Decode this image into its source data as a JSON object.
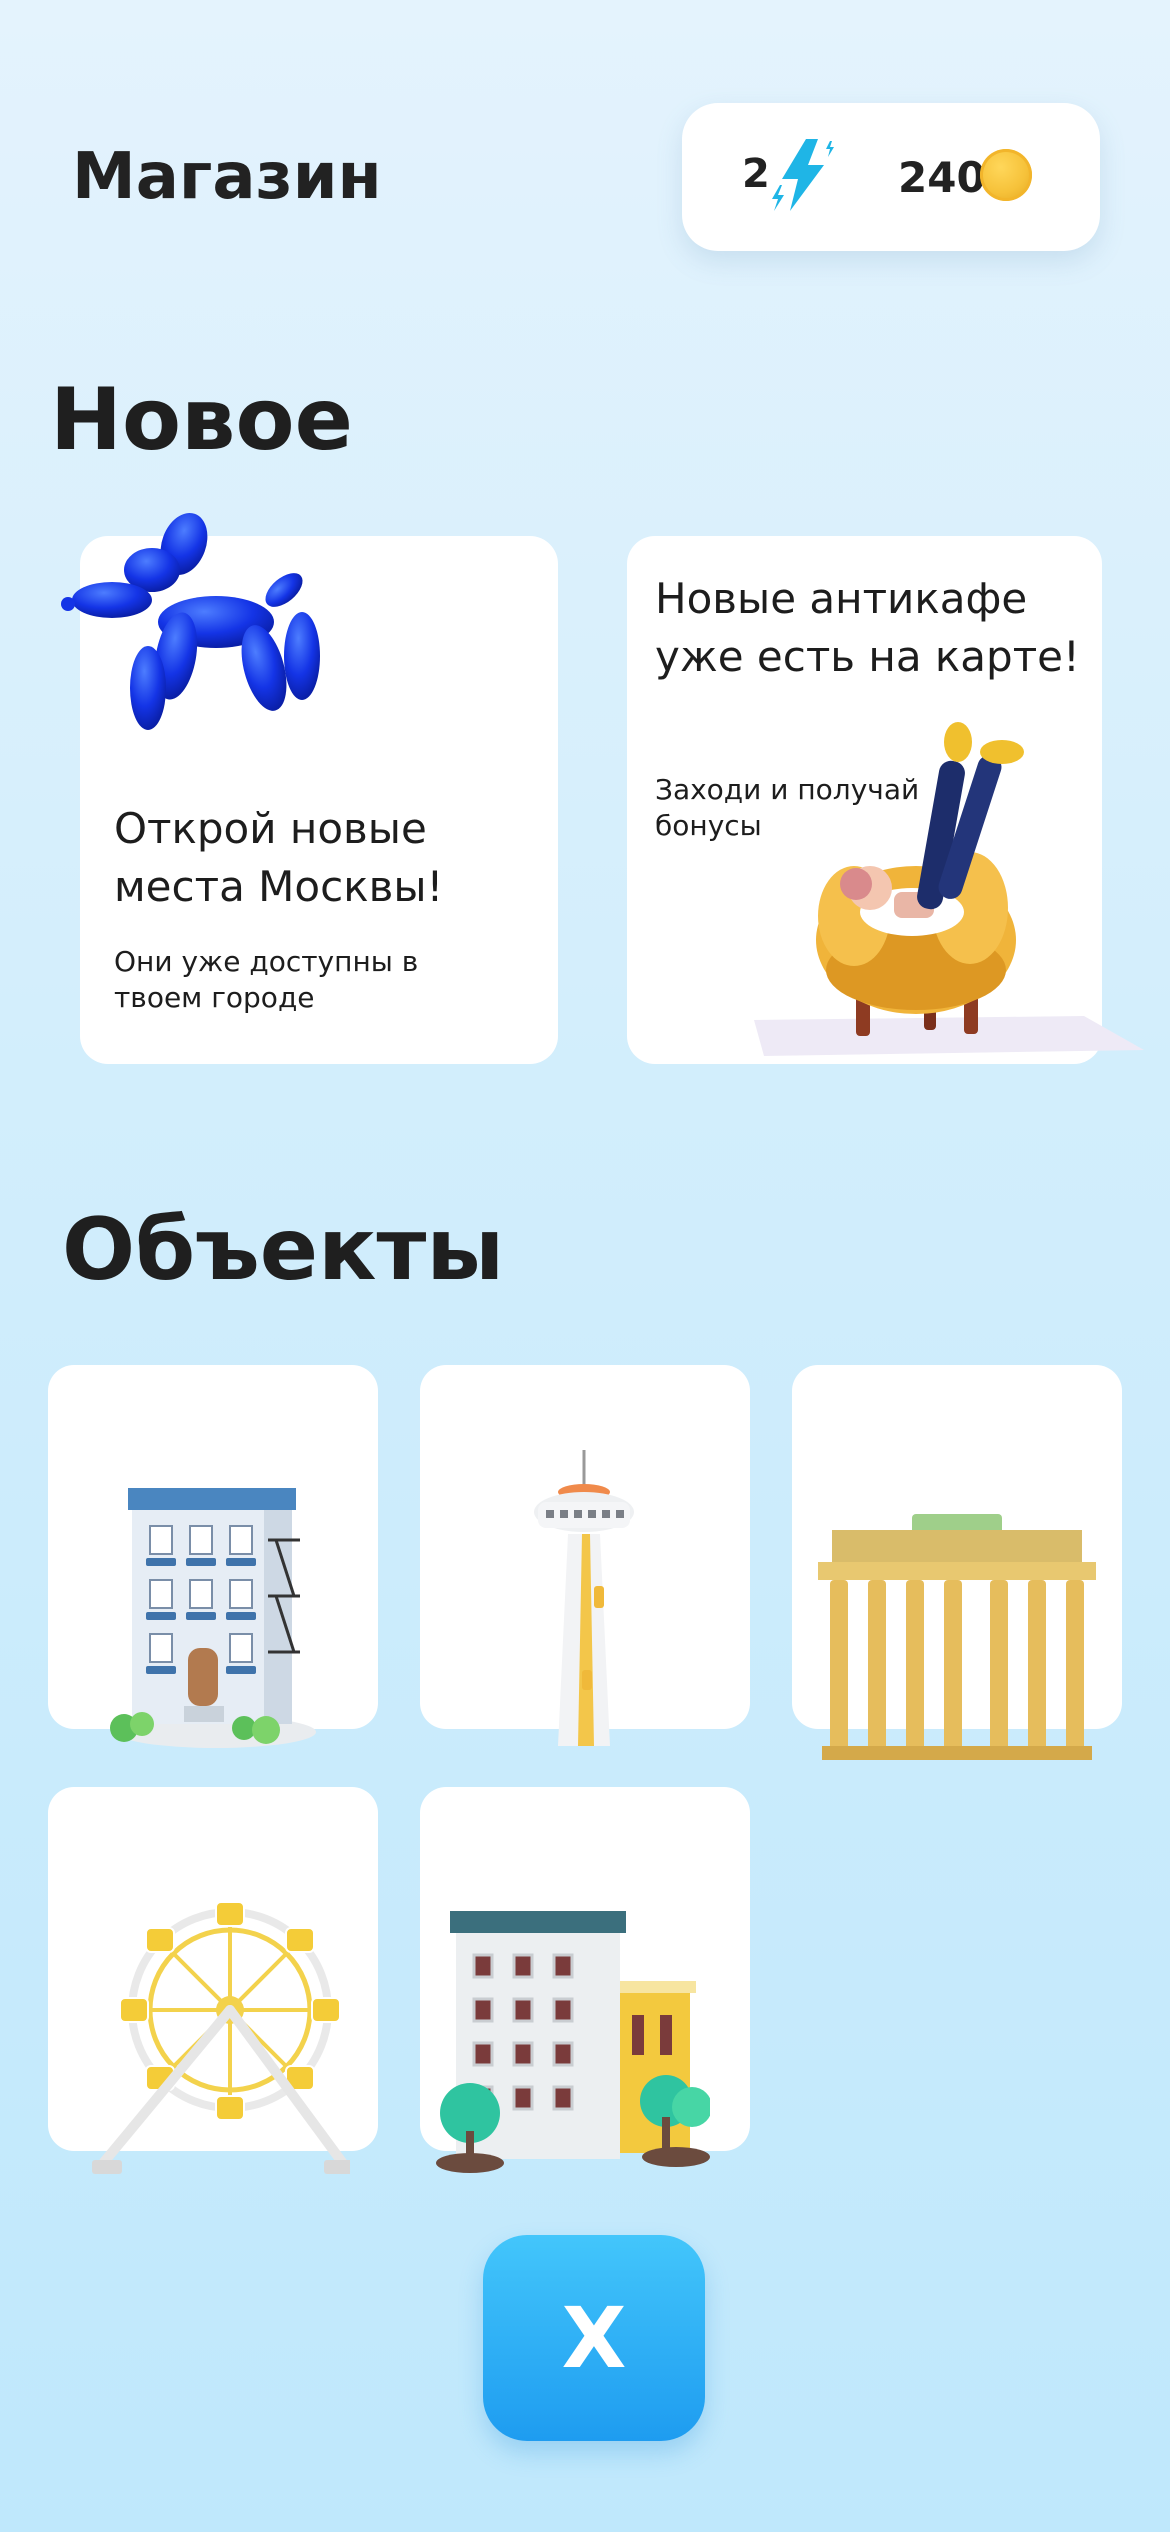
{
  "header": {
    "title": "Магазин",
    "energy_count": "2",
    "energy_icon": "lightning-icon",
    "coins": "240",
    "coin_icon": "coin-icon"
  },
  "sections": {
    "new_title": "Новое",
    "objects_title": "Объекты"
  },
  "news": [
    {
      "title": "Открой новые места Москвы!",
      "text": "Они уже доступны в твоем городе",
      "image": "balloon-dog-icon"
    },
    {
      "title": "Новые антикафе уже есть на карте!",
      "text": "Заходи и получай бонусы",
      "image": "girl-in-armchair-illustration"
    }
  ],
  "objects": [
    {
      "image": "apartment-building-icon"
    },
    {
      "image": "tv-tower-icon"
    },
    {
      "image": "brandenburg-gate-icon"
    },
    {
      "image": "ferris-wheel-icon"
    },
    {
      "image": "city-houses-icon"
    }
  ],
  "close_button": {
    "label": "X"
  },
  "colors": {
    "accent": "#1e9cf0",
    "background": "#d3eefc",
    "card": "#ffffff",
    "energy": "#1fb5e6",
    "coin": "#f6c23a"
  }
}
